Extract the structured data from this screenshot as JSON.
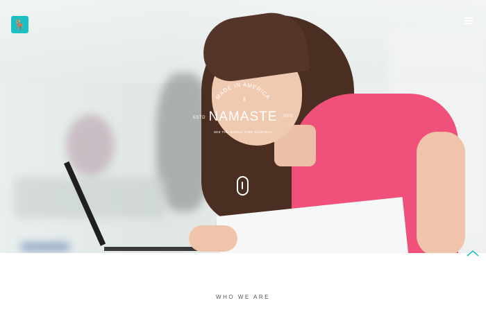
{
  "header": {
    "logo_glyph": "🦌",
    "menu_icon": "hamburger-icon"
  },
  "hero": {
    "badge": {
      "arc_text": "MADE IN AMERICA",
      "title": "NAMASTE",
      "estd": "ESTD",
      "year": "2001",
      "tagline": "SEE THE WORLD. FIND YOURSELF"
    },
    "scroll_icon": "mouse-scroll-icon"
  },
  "back_to_top_icon": "chevron-up-icon",
  "section": {
    "label": "WHO WE ARE"
  },
  "colors": {
    "accent": "#1bbfc2",
    "shirt": "#f0517a"
  }
}
